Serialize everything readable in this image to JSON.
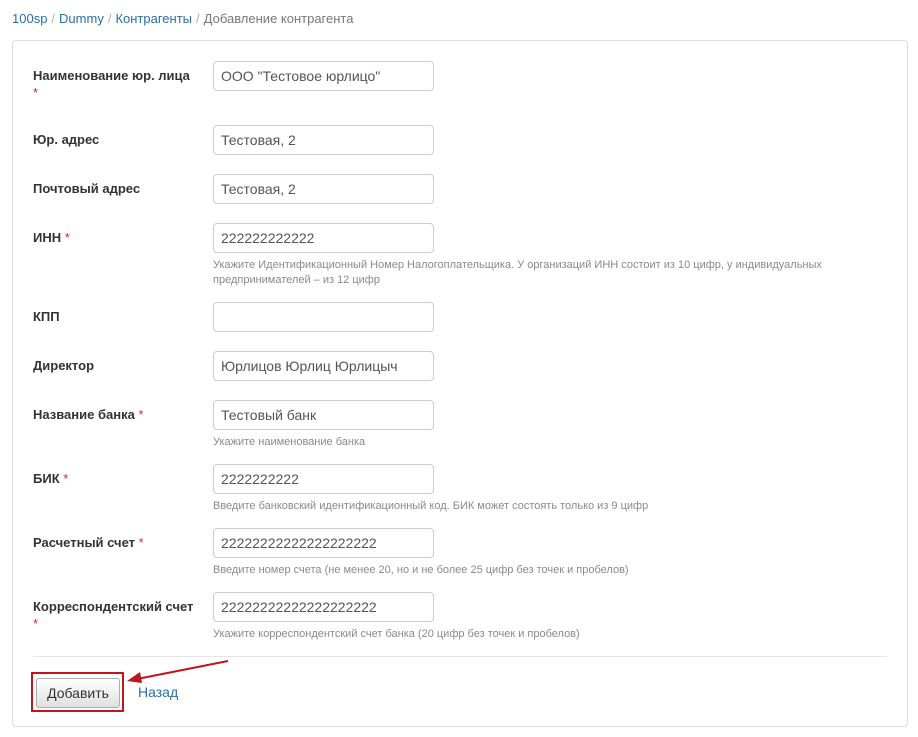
{
  "breadcrumb": {
    "items": [
      "100sp",
      "Dummy",
      "Контрагенты"
    ],
    "separator": "/",
    "current": "Добавление контрагента"
  },
  "form": {
    "required_mark": "*",
    "fields": [
      {
        "label": "Наименование юр. лица",
        "required": true,
        "value": "ООО \"Тестовое юрлицо\"",
        "help": ""
      },
      {
        "label": "Юр. адрес",
        "required": false,
        "value": "Тестовая, 2",
        "help": ""
      },
      {
        "label": "Почтовый адрес",
        "required": false,
        "value": "Тестовая, 2",
        "help": ""
      },
      {
        "label": "ИНН",
        "required": true,
        "value": "222222222222",
        "help": "Укажите Идентификационный Номер Налогоплательщика. У организаций ИНН состоит из 10 цифр, у индивидуальных предпринимателей – из 12 цифр"
      },
      {
        "label": "КПП",
        "required": false,
        "value": "",
        "help": ""
      },
      {
        "label": "Директор",
        "required": false,
        "value": "Юрлицов Юрлиц Юрлицыч",
        "help": ""
      },
      {
        "label": "Название банка",
        "required": true,
        "value": "Тестовый банк",
        "help": "Укажите наименование банка"
      },
      {
        "label": "БИК",
        "required": true,
        "value": "2222222222",
        "help": "Введите банковский идентификационный код. БИК может состоять только из 9 цифр"
      },
      {
        "label": "Расчетный счет",
        "required": true,
        "value": "22222222222222222222",
        "help": "Введите номер счета (не менее 20, но и не более 25 цифр без точек и пробелов)"
      },
      {
        "label": "Корреспондентский счет",
        "required": true,
        "value": "22222222222222222222",
        "help": "Укажите корреспондентский счет банка (20 цифр без точек и пробелов)"
      }
    ]
  },
  "actions": {
    "submit_label": "Добавить",
    "back_label": "Назад"
  },
  "colors": {
    "link": "#2a6ea6",
    "required": "#c9302c",
    "annotation": "#c0151b"
  }
}
